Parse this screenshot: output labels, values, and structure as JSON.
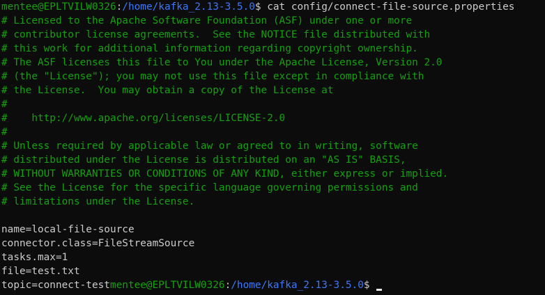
{
  "terminal": {
    "prompt": {
      "user_host": "mentee@EPLTVILW0326",
      "sep": ":",
      "path": "/home/kafka_2.13-3.5.0",
      "symbol": "$ "
    },
    "command": "cat config/connect-file-source.properties",
    "comments": [
      "# Licensed to the Apache Software Foundation (ASF) under one or more",
      "# contributor license agreements.  See the NOTICE file distributed with",
      "# this work for additional information regarding copyright ownership.",
      "# The ASF licenses this file to You under the Apache License, Version 2.0",
      "# (the \"License\"); you may not use this file except in compliance with",
      "# the License.  You may obtain a copy of the License at",
      "#",
      "#    http://www.apache.org/licenses/LICENSE-2.0",
      "#",
      "# Unless required by applicable law or agreed to in writing, software",
      "# distributed under the License is distributed on an \"AS IS\" BASIS,",
      "# WITHOUT WARRANTIES OR CONDITIONS OF ANY KIND, either express or implied.",
      "# See the License for the specific language governing permissions and",
      "# limitations under the License."
    ],
    "properties": [
      "name=local-file-source",
      "connector.class=FileStreamSource",
      "tasks.max=1",
      "file=test.txt"
    ],
    "last_property": "topic=connect-test",
    "colors": {
      "background": "#0c0c0c",
      "green": "#13a10e",
      "blue": "#3b78ff",
      "text": "#cccccc"
    }
  }
}
